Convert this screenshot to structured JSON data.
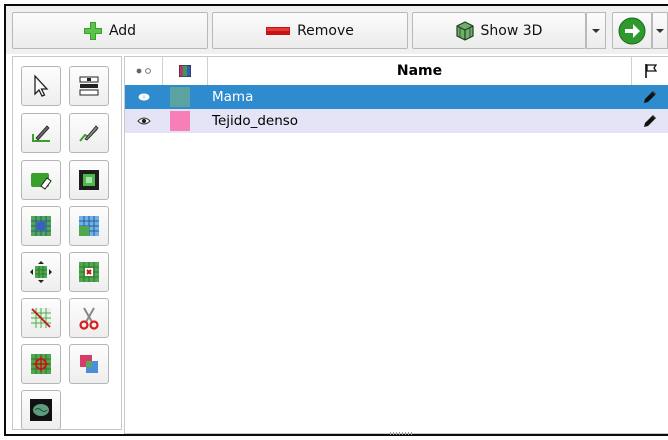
{
  "toolbar": {
    "add_label": "Add",
    "remove_label": "Remove",
    "show3d_label": "Show 3D"
  },
  "colors": {
    "selection": "#2e8bce",
    "alt_row": "#e4e4f6",
    "add_green": "#3aa02c",
    "remove_red": "#cc1111",
    "next_green": "#2e9a2e"
  },
  "tools": [
    "select-arrow-icon",
    "threshold-icon",
    "paint-brush-icon",
    "draw-line-icon",
    "erase-icon",
    "region-grow-icon",
    "grid-select-icon",
    "grid-select-alt-icon",
    "dilate-icon",
    "erode-icon",
    "grid-edit-icon",
    "scissors-icon",
    "crosshair-grid-icon",
    "overlap-icon",
    "brain-icon"
  ],
  "table": {
    "header_name": "Name",
    "rows": [
      {
        "name": "Mama",
        "color": "#5ba3a0",
        "visible": true
      },
      {
        "name": "Tejido_denso",
        "color": "#f77fb8",
        "visible": true
      }
    ]
  }
}
